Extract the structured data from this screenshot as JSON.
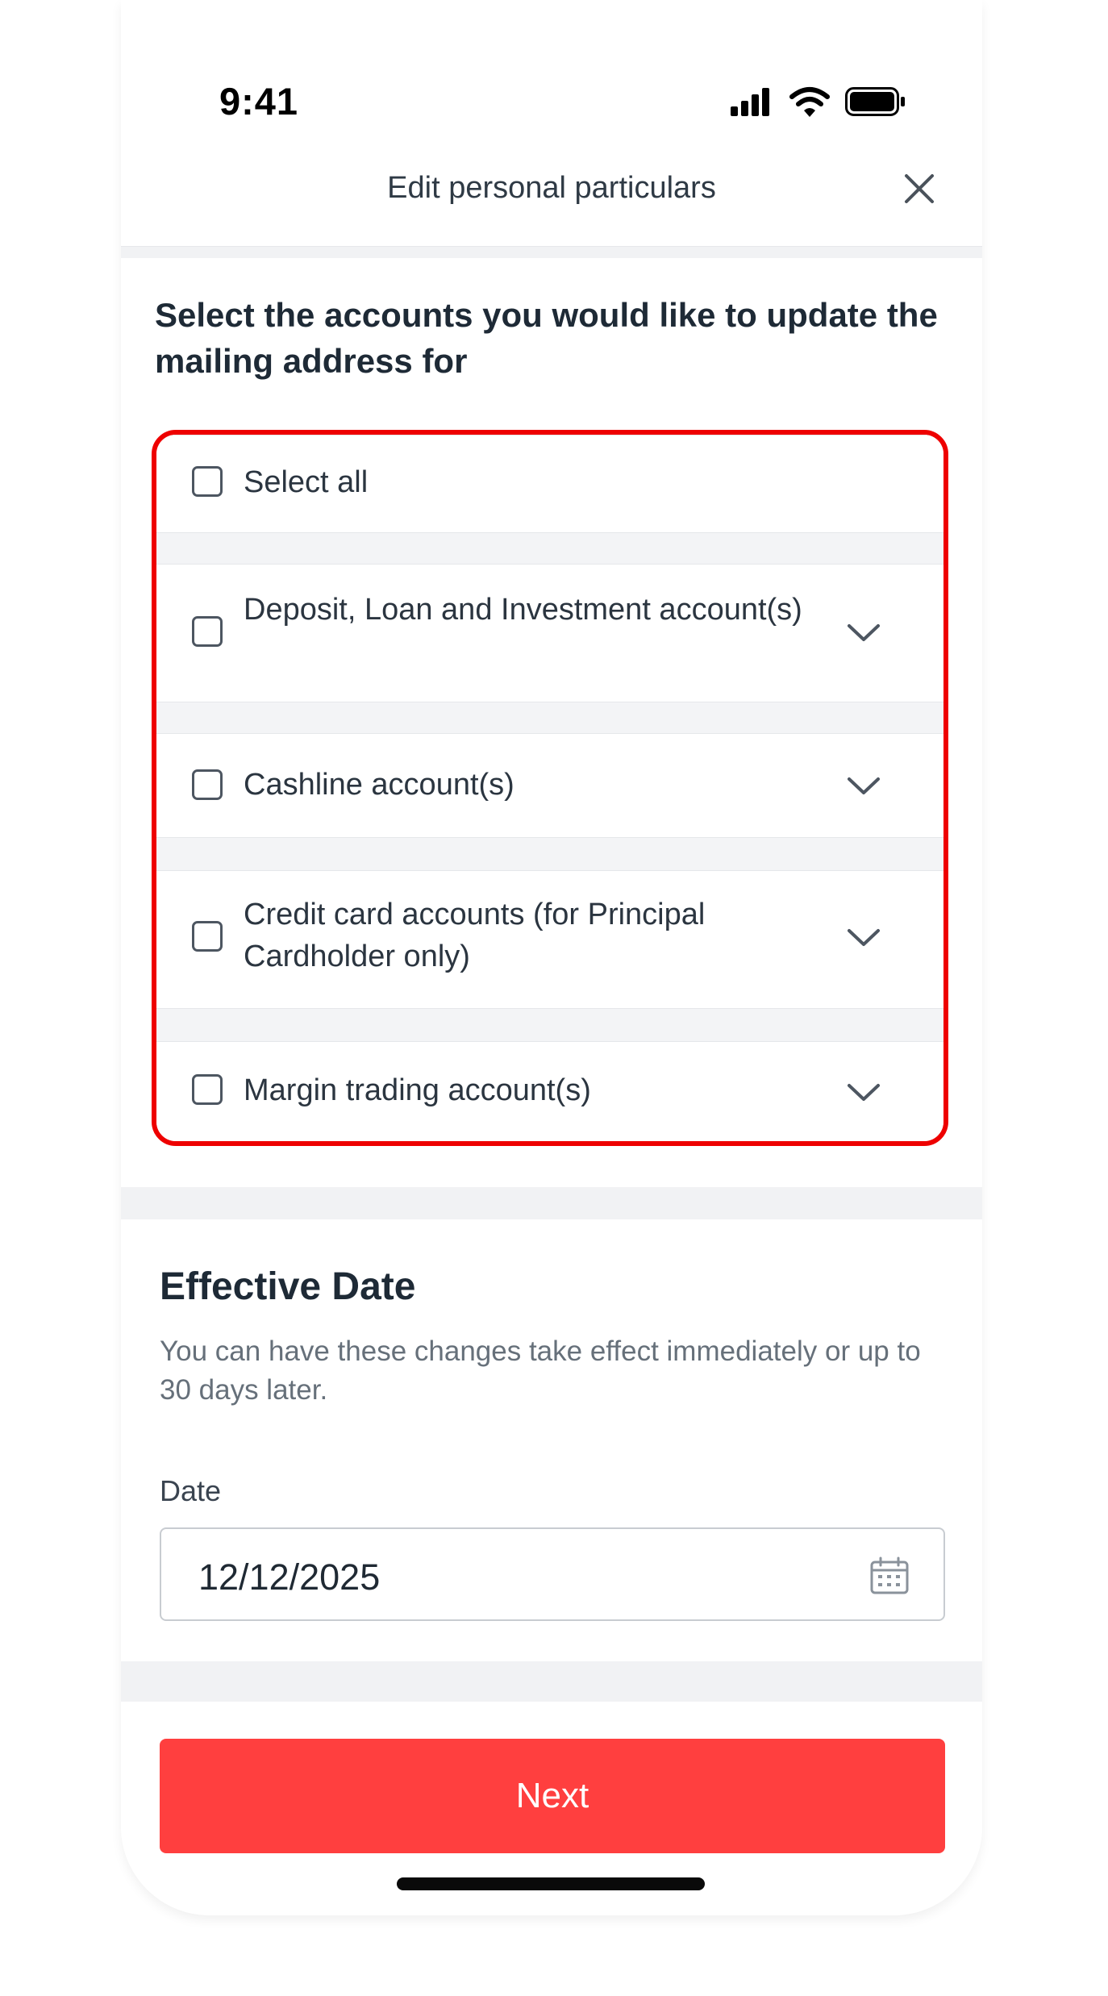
{
  "status_bar": {
    "time": "9:41"
  },
  "header": {
    "title": "Edit personal particulars"
  },
  "accounts_section": {
    "heading": "Select the accounts you would like to update the mailing address for",
    "items": [
      {
        "label": "Select all",
        "checked": false,
        "expandable": false
      },
      {
        "label": "Deposit, Loan and Investment account(s)",
        "checked": false,
        "expandable": true
      },
      {
        "label": "Cashline account(s)",
        "checked": false,
        "expandable": true
      },
      {
        "label": "Credit card accounts (for Principal Cardholder only)",
        "checked": false,
        "expandable": true
      },
      {
        "label": "Margin trading account(s)",
        "checked": false,
        "expandable": true
      }
    ],
    "highlight_color": "#ee0000"
  },
  "effective_date": {
    "title": "Effective Date",
    "description": "You can have these changes take effect immediately or up to 30 days later.",
    "date_label": "Date",
    "date_value": "12/12/2025"
  },
  "footer": {
    "next_label": "Next",
    "button_color": "#ff3f3f"
  }
}
